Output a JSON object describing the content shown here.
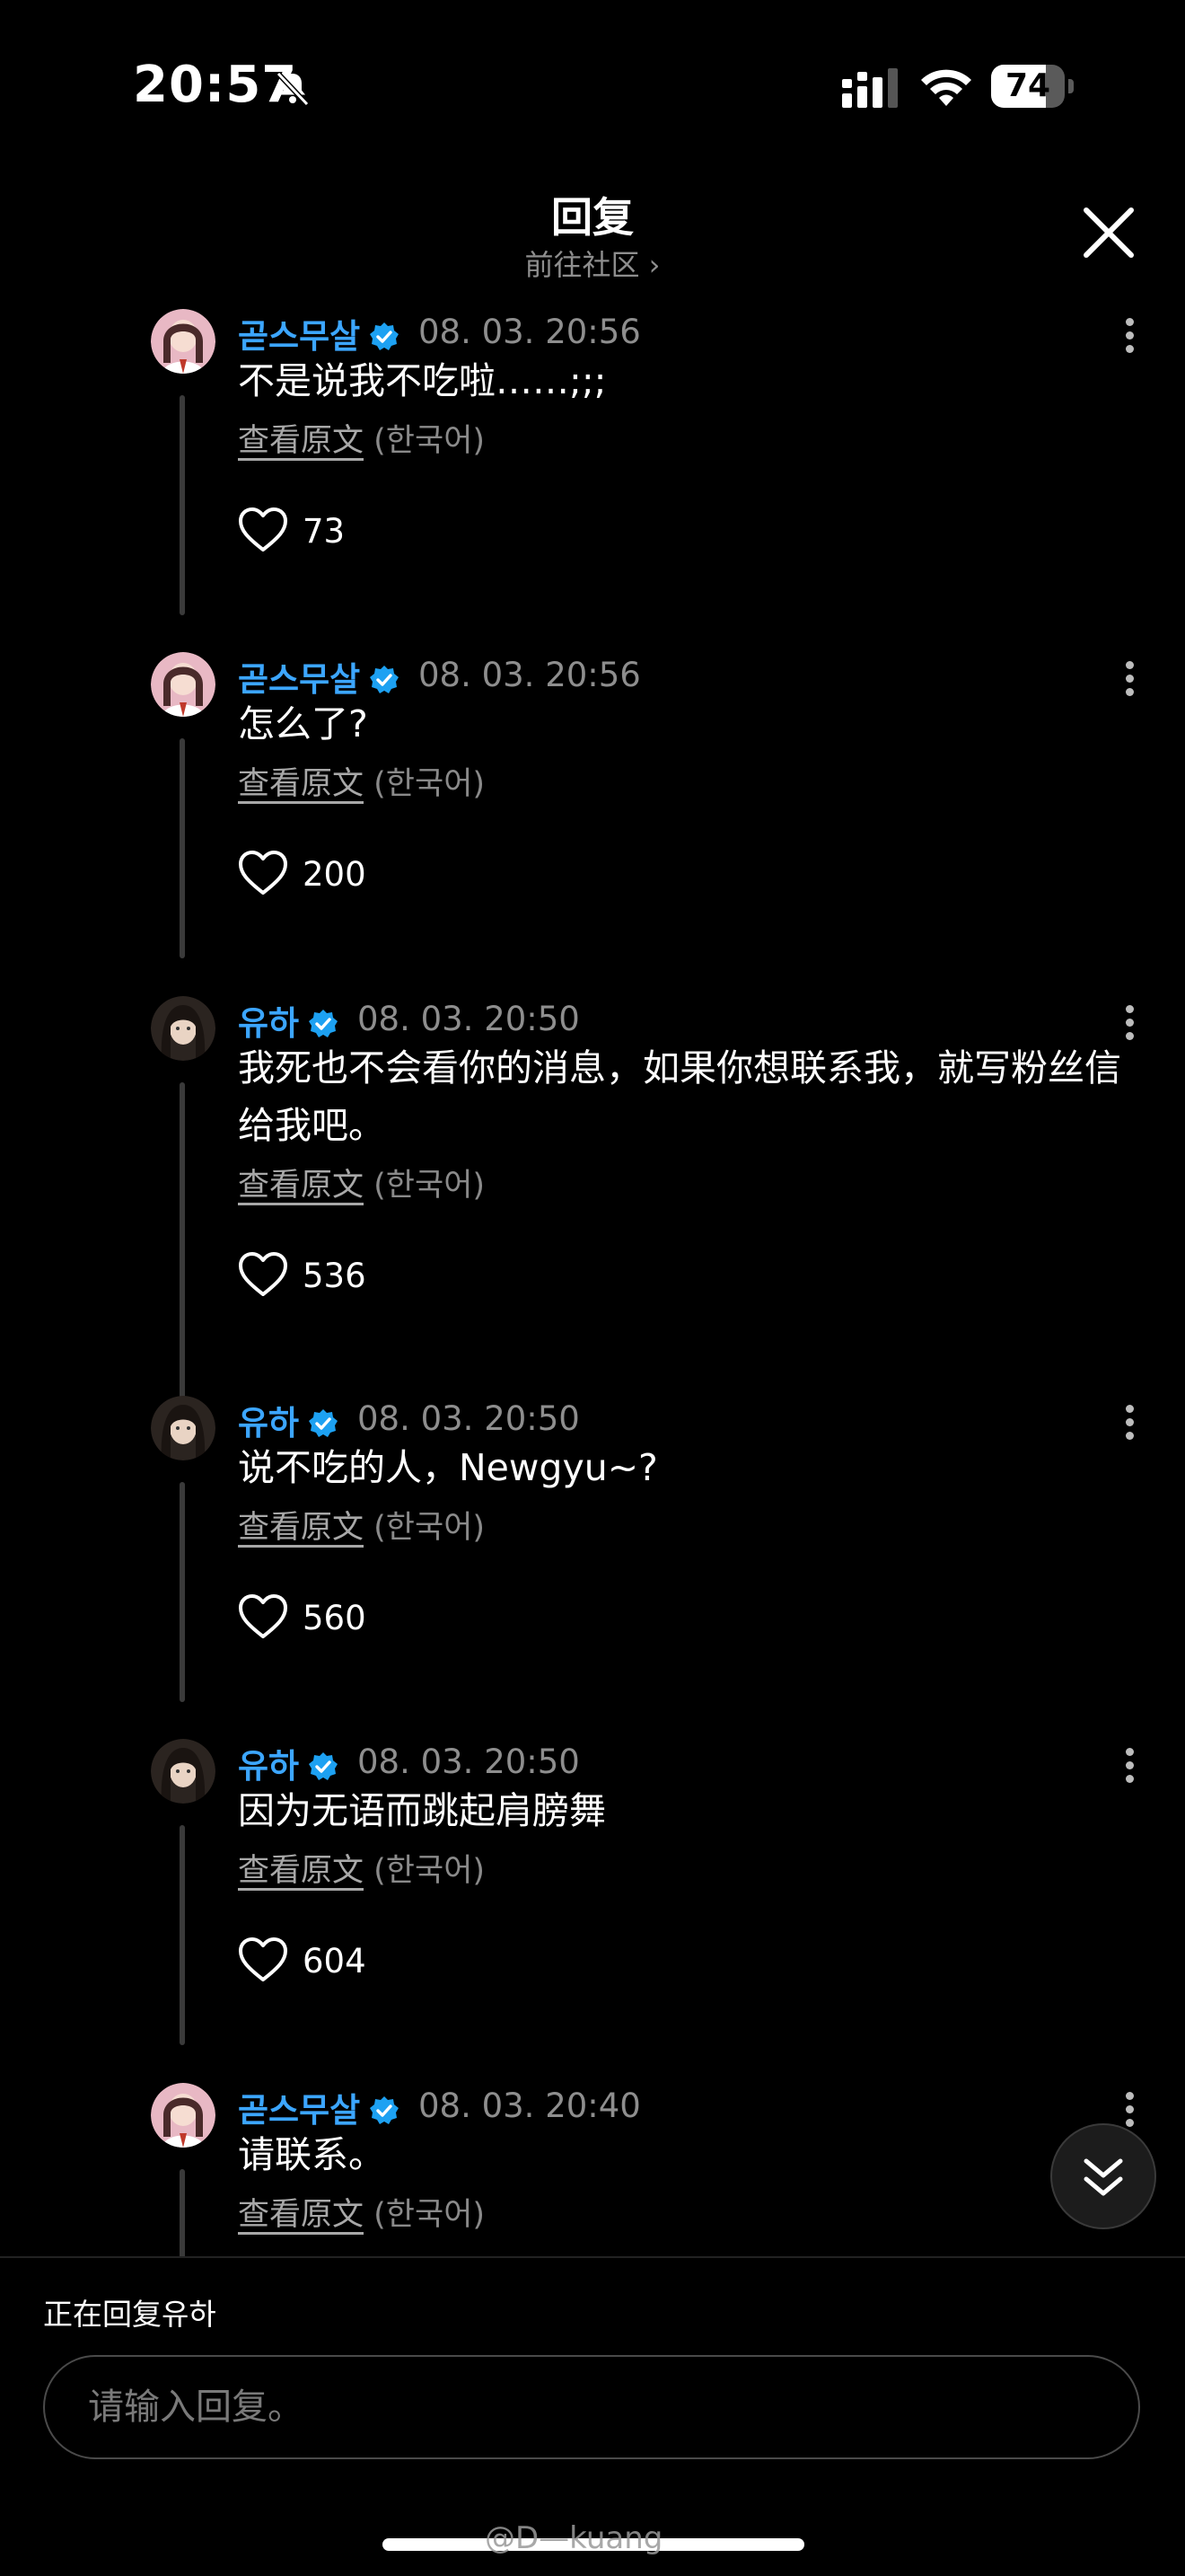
{
  "status_bar": {
    "time": "20:57",
    "battery": "74",
    "battery_level": 0.74
  },
  "header": {
    "title": "回复",
    "subtitle": "前往社区 ›"
  },
  "comments": [
    {
      "user": "곧스무살",
      "date": "08. 03. 20:56",
      "text": "不是说我不吃啦……;;;",
      "orig_link": "查看原文",
      "orig_lang": "(한국어)",
      "likes": "73",
      "avatar": "pink"
    },
    {
      "user": "곧스무살",
      "date": "08. 03. 20:56",
      "text": "怎么了?",
      "orig_link": "查看原文",
      "orig_lang": "(한국어)",
      "likes": "200",
      "avatar": "pink"
    },
    {
      "user": "유하",
      "date": "08. 03. 20:50",
      "text": "我死也不会看你的消息，如果你想联系我，就写粉丝信给我吧。",
      "orig_link": "查看原文",
      "orig_lang": "(한국어)",
      "likes": "536",
      "avatar": "dark"
    },
    {
      "user": "유하",
      "date": "08. 03. 20:50",
      "text": "说不吃的人，Newgyu~?",
      "orig_link": "查看原文",
      "orig_lang": "(한국어)",
      "likes": "560",
      "avatar": "dark"
    },
    {
      "user": "유하",
      "date": "08. 03. 20:50",
      "text": "因为无语而跳起肩膀舞",
      "orig_link": "查看原文",
      "orig_lang": "(한국어)",
      "likes": "604",
      "avatar": "dark"
    },
    {
      "user": "곧스무살",
      "date": "08. 03. 20:40",
      "text": "请联系。",
      "orig_link": "查看原文",
      "orig_lang": "(한국어)",
      "likes": "",
      "avatar": "pink"
    }
  ],
  "reply_bar": {
    "replying_to": "正在回复유하",
    "placeholder": "请输入回复。"
  },
  "watermark": "@D—kuang",
  "colors": {
    "username": "#3ca6ff",
    "verified": "#1da1f2",
    "muted": "#8e8e8e",
    "background": "#000000"
  }
}
